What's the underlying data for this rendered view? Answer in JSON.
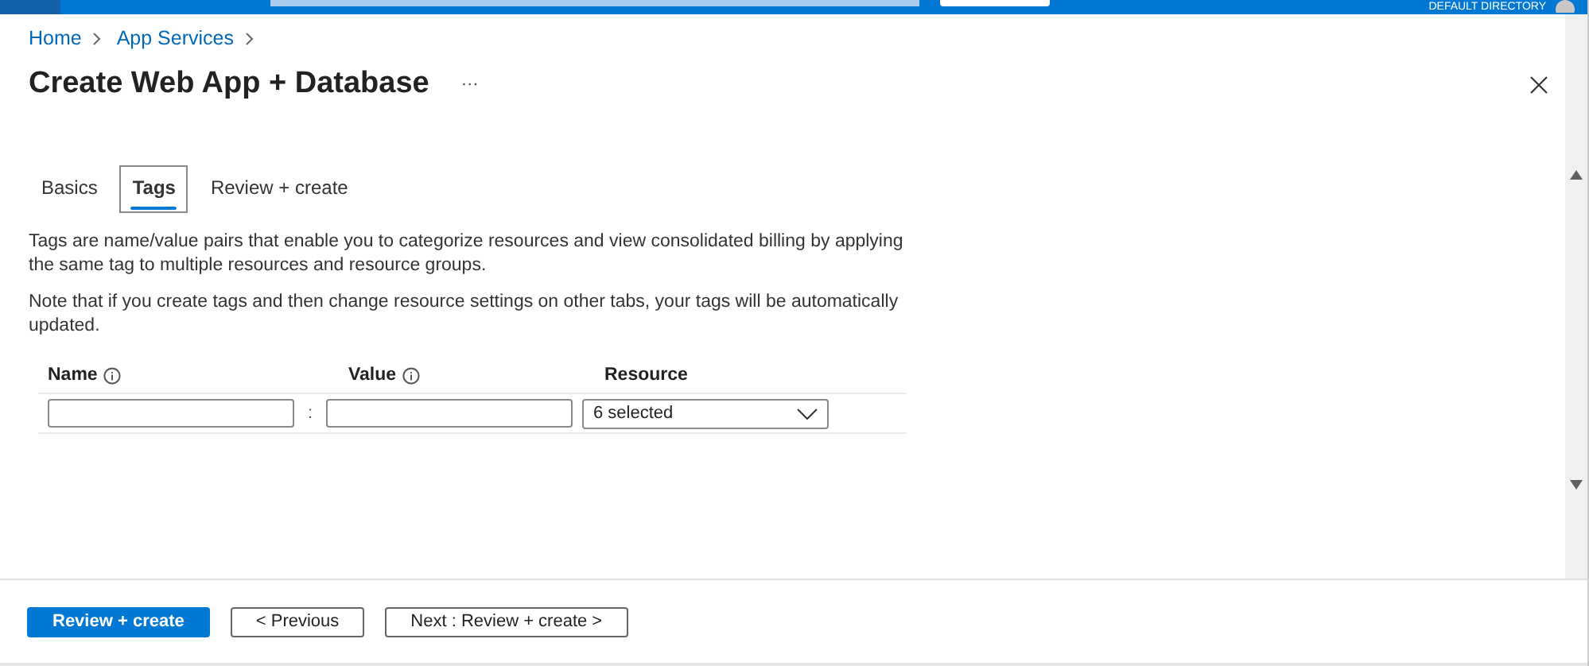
{
  "top_bar": {
    "directory": "DEFAULT DIRECTORY"
  },
  "breadcrumb": [
    "Home",
    "App Services"
  ],
  "title": "Create Web App + Database",
  "more": "···",
  "tabs": [
    {
      "label": "Basics",
      "selected": false
    },
    {
      "label": "Tags",
      "selected": true
    },
    {
      "label": "Review + create",
      "selected": false
    }
  ],
  "description": "Tags are name/value pairs that enable you to categorize resources and view consolidated billing by applying the same tag to multiple resources and resource groups.",
  "note": "Note that if you create tags and then change resource settings on other tabs, your tags will be automatically updated.",
  "table": {
    "columns": [
      {
        "label": "Name",
        "info": true
      },
      {
        "label": "Value",
        "info": true
      },
      {
        "label": "Resource",
        "info": false
      }
    ],
    "rows": [
      {
        "name": "",
        "separator": ":",
        "value": "",
        "resource": "6 selected"
      }
    ]
  },
  "footer": {
    "buttons": [
      {
        "label": "Review + create",
        "kind": "primary"
      },
      {
        "label": "< Previous",
        "kind": "secondary"
      },
      {
        "label": "Next : Review + create >",
        "kind": "secondary"
      }
    ]
  }
}
